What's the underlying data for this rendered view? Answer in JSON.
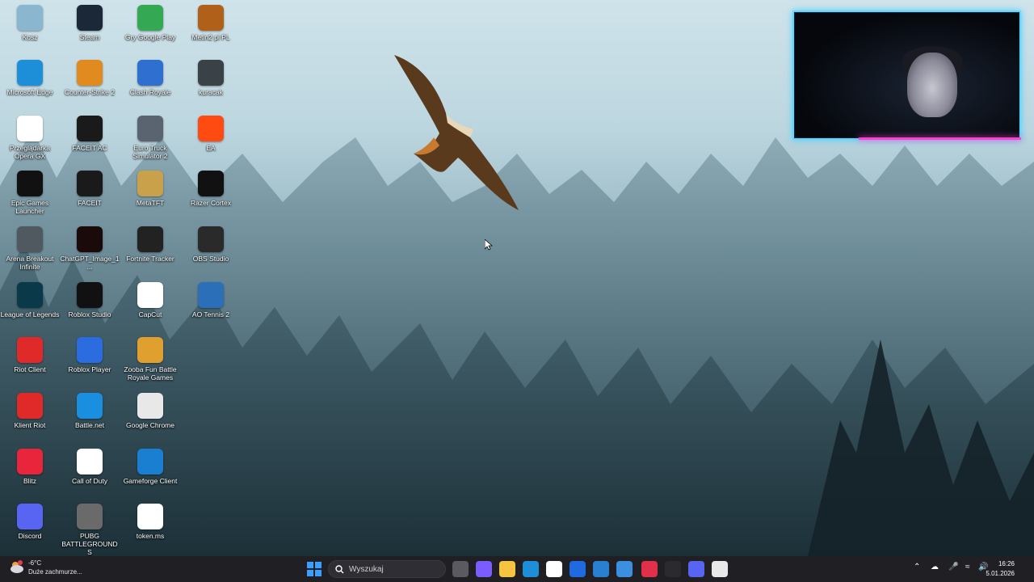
{
  "desktop": {
    "icons": [
      {
        "label": "Kosz",
        "icon": "recycle-bin-icon",
        "color": "#8ab6d0"
      },
      {
        "label": "Steam",
        "icon": "steam-icon",
        "color": "#1b2838"
      },
      {
        "label": "Gry Google Play",
        "icon": "google-play-games-icon",
        "color": "#34a853"
      },
      {
        "label": "Metin2 pl PL",
        "icon": "metin2-icon",
        "color": "#b06018"
      },
      {
        "label": "Microsoft Edge",
        "icon": "edge-icon",
        "color": "#1c8fd8"
      },
      {
        "label": "Counter-Strike 2",
        "icon": "cs2-icon",
        "color": "#e08a20"
      },
      {
        "label": "Clash Royale",
        "icon": "clash-royale-icon",
        "color": "#2f6fd0"
      },
      {
        "label": "kuracak",
        "icon": "image-thumbnail-icon",
        "color": "#3a4248"
      },
      {
        "label": "Przeglądarka Opera GX",
        "icon": "opera-gx-icon",
        "color": "#ffffff"
      },
      {
        "label": "FACEIT AC",
        "icon": "faceit-ac-icon",
        "color": "#1a1a1a"
      },
      {
        "label": "Euro Truck Simulator 2",
        "icon": "euro-truck-icon",
        "color": "#5a6470"
      },
      {
        "label": "EA",
        "icon": "ea-icon",
        "color": "#ff4a12"
      },
      {
        "label": "Epic Games Launcher",
        "icon": "epic-games-icon",
        "color": "#111111"
      },
      {
        "label": "FACEIT",
        "icon": "faceit-icon",
        "color": "#1a1a1a"
      },
      {
        "label": "MetaTFT",
        "icon": "metatft-icon",
        "color": "#c8a14a"
      },
      {
        "label": "Razer Cortex",
        "icon": "razer-cortex-icon",
        "color": "#111111"
      },
      {
        "label": "Arena Breakout Infinite",
        "icon": "arena-breakout-icon",
        "color": "#505860"
      },
      {
        "label": "ChatGPT_Image_1...",
        "icon": "image-file-icon",
        "color": "#1a0a0a"
      },
      {
        "label": "Fortnite Tracker",
        "icon": "fortnite-tracker-icon",
        "color": "#222222"
      },
      {
        "label": "OBS Studio",
        "icon": "obs-icon",
        "color": "#2a2a2a"
      },
      {
        "label": "League of Legends",
        "icon": "league-of-legends-icon",
        "color": "#0a3a4a"
      },
      {
        "label": "Roblox Studio",
        "icon": "roblox-studio-icon",
        "color": "#111111"
      },
      {
        "label": "CapCut",
        "icon": "capcut-icon",
        "color": "#ffffff"
      },
      {
        "label": "AO Tennis 2",
        "icon": "ao-tennis-icon",
        "color": "#2a6fb8"
      },
      {
        "label": "Riot Client",
        "icon": "riot-client-icon",
        "color": "#e02a2a"
      },
      {
        "label": "Roblox Player",
        "icon": "roblox-player-icon",
        "color": "#2b6ce0"
      },
      {
        "label": "Zooba Fun Battle Royale Games",
        "icon": "zooba-icon",
        "color": "#e0a030"
      },
      {
        "label": "Klient Riot",
        "icon": "riot-client-icon",
        "color": "#e02a2a"
      },
      {
        "label": "Battle.net",
        "icon": "battlenet-icon",
        "color": "#1a8fe0"
      },
      {
        "label": "Google Chrome",
        "icon": "chrome-icon",
        "color": "#e8e8e8"
      },
      {
        "label": "Blitz",
        "icon": "blitz-icon",
        "color": "#e8253a"
      },
      {
        "label": "Call of Duty",
        "icon": "file-icon",
        "color": "#ffffff"
      },
      {
        "label": "Gameforge Client",
        "icon": "gameforge-icon",
        "color": "#1a7fd0"
      },
      {
        "label": "Discord",
        "icon": "discord-icon",
        "color": "#5865f2"
      },
      {
        "label": "PUBG BATTLEGROUNDS",
        "icon": "pubg-icon",
        "color": "#6a6a6a"
      },
      {
        "label": "token.ms",
        "icon": "file-icon",
        "color": "#ffffff"
      }
    ]
  },
  "taskbar": {
    "weather": {
      "temp": "-6°C",
      "desc": "Duże zachmurze..."
    },
    "search_placeholder": "Wyszukaj",
    "apps": [
      {
        "icon": "task-view-icon",
        "color": "#5a5a60"
      },
      {
        "icon": "copilot-icon",
        "color": "#7a5cff"
      },
      {
        "icon": "file-explorer-icon",
        "color": "#f5c542"
      },
      {
        "icon": "edge-icon",
        "color": "#1c8fd8"
      },
      {
        "icon": "microsoft-store-icon",
        "color": "#ffffff"
      },
      {
        "icon": "dropbox-icon",
        "color": "#1f6ae0"
      },
      {
        "icon": "app-icon",
        "color": "#2a7fd0"
      },
      {
        "icon": "mail-icon",
        "color": "#3a8fe0"
      },
      {
        "icon": "opera-gx-icon",
        "color": "#e0304a"
      },
      {
        "icon": "steam-tray-icon",
        "color": "#2a2a30"
      },
      {
        "icon": "discord-icon",
        "color": "#5865f2"
      },
      {
        "icon": "chrome-icon",
        "color": "#e8e8e8"
      }
    ],
    "clock": {
      "time": "16:26",
      "date": "5.01.2026"
    }
  }
}
